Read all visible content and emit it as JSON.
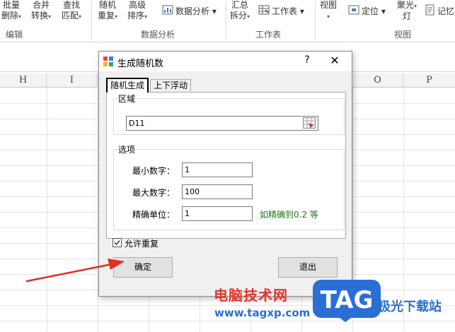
{
  "ribbon": {
    "batch_delete": [
      "批量",
      "删除"
    ],
    "merge_convert": [
      "合并",
      "转换"
    ],
    "find_match": [
      "查找",
      "匹配"
    ],
    "random_repeat": [
      "随机",
      "重复"
    ],
    "advanced_sort": [
      "高级",
      "排序"
    ],
    "data_analysis": "数据分析",
    "summary_split": [
      "汇总",
      "拆分"
    ],
    "worksheet": "工作表",
    "view": "视图",
    "locate": "定位",
    "spotlight": [
      "聚光",
      "灯"
    ],
    "memo": "记忆",
    "groups": {
      "edit": "编辑",
      "data_analysis": "数据分析",
      "worksheet": "工作表",
      "view": "视图"
    }
  },
  "sheet": {
    "columns": [
      "H",
      "I",
      "O",
      "P"
    ]
  },
  "dialog": {
    "title": "生成随机数",
    "help": "?",
    "close": "✕",
    "tabs": [
      "随机生成",
      "上下浮动"
    ],
    "range_group": "区域",
    "range_value": "D11",
    "options_group": "选项",
    "min_label": "最小数字：",
    "min_value": "1",
    "max_label": "最大数字：",
    "max_value": "100",
    "precision_label": "精确单位：",
    "precision_value": "1",
    "precision_hint": "如精确到0.2 等",
    "allow_duplicate": "允许重复",
    "allow_duplicate_checked": true,
    "ok": "确定",
    "exit": "退出"
  },
  "watermark": {
    "site_name": "电脑技术网",
    "site_url": "www.tagxp.com",
    "logo": "TAG",
    "brand": "极光下载站"
  },
  "colors": {
    "hint_green": "#1a7a1a",
    "arrow_red": "#e03020",
    "tag_blue": "#2b6fd6",
    "watermark_red": "#e8322a"
  }
}
